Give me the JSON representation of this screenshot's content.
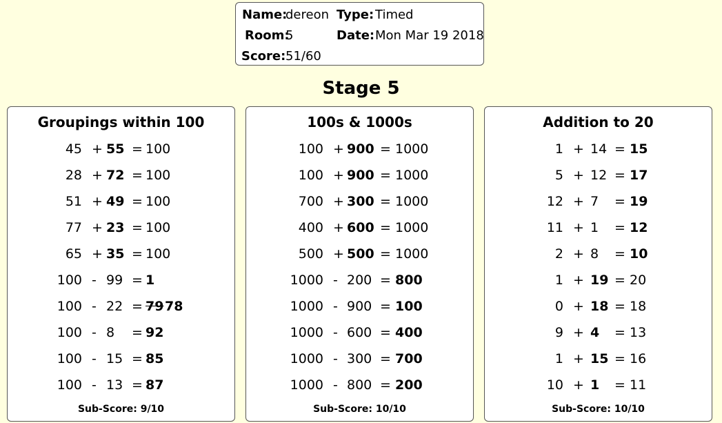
{
  "info": {
    "name_label": "Name:",
    "name_value": "dereon",
    "type_label": "Type:",
    "type_value": "Timed",
    "room_label": "Room:",
    "room_value": "5",
    "date_label": "Date:",
    "date_value": "Mon Mar 19 2018",
    "score_label": "Score:",
    "score_value": "51/60"
  },
  "stage_title": "Stage 5",
  "panels": [
    {
      "title": "Groupings within 100",
      "subscore": "Sub-Score: 9/10",
      "rows": [
        {
          "a": "45",
          "op": "+",
          "b": "55",
          "eq": "=",
          "c": "100",
          "bold": "b"
        },
        {
          "a": "28",
          "op": "+",
          "b": "72",
          "eq": "=",
          "c": "100",
          "bold": "b"
        },
        {
          "a": "51",
          "op": "+",
          "b": "49",
          "eq": "=",
          "c": "100",
          "bold": "b"
        },
        {
          "a": "77",
          "op": "+",
          "b": "23",
          "eq": "=",
          "c": "100",
          "bold": "b"
        },
        {
          "a": "65",
          "op": "+",
          "b": "35",
          "eq": "=",
          "c": "100",
          "bold": "b"
        },
        {
          "a": "100",
          "op": "-",
          "b": "99",
          "eq": "=",
          "c": "1",
          "bold": "c"
        },
        {
          "a": "100",
          "op": "-",
          "b": "22",
          "eq": "=",
          "c": "79",
          "c_correct": "78",
          "bold": "c"
        },
        {
          "a": "100",
          "op": "-",
          "b": "8",
          "eq": "=",
          "c": "92",
          "bold": "c"
        },
        {
          "a": "100",
          "op": "-",
          "b": "15",
          "eq": "=",
          "c": "85",
          "bold": "c"
        },
        {
          "a": "100",
          "op": "-",
          "b": "13",
          "eq": "=",
          "c": "87",
          "bold": "c"
        }
      ]
    },
    {
      "title": "100s & 1000s",
      "subscore": "Sub-Score: 10/10",
      "rows": [
        {
          "a": "100",
          "op": "+",
          "b": "900",
          "eq": "=",
          "c": "1000",
          "bold": "b"
        },
        {
          "a": "100",
          "op": "+",
          "b": "900",
          "eq": "=",
          "c": "1000",
          "bold": "b"
        },
        {
          "a": "700",
          "op": "+",
          "b": "300",
          "eq": "=",
          "c": "1000",
          "bold": "b"
        },
        {
          "a": "400",
          "op": "+",
          "b": "600",
          "eq": "=",
          "c": "1000",
          "bold": "b"
        },
        {
          "a": "500",
          "op": "+",
          "b": "500",
          "eq": "=",
          "c": "1000",
          "bold": "b"
        },
        {
          "a": "1000",
          "op": "-",
          "b": "200",
          "eq": "=",
          "c": "800",
          "bold": "c"
        },
        {
          "a": "1000",
          "op": "-",
          "b": "900",
          "eq": "=",
          "c": "100",
          "bold": "c"
        },
        {
          "a": "1000",
          "op": "-",
          "b": "600",
          "eq": "=",
          "c": "400",
          "bold": "c"
        },
        {
          "a": "1000",
          "op": "-",
          "b": "300",
          "eq": "=",
          "c": "700",
          "bold": "c"
        },
        {
          "a": "1000",
          "op": "-",
          "b": "800",
          "eq": "=",
          "c": "200",
          "bold": "c"
        }
      ]
    },
    {
      "title": "Addition to 20",
      "subscore": "Sub-Score: 10/10",
      "rows": [
        {
          "a": "1",
          "op": "+",
          "b": "14",
          "eq": "=",
          "c": "15",
          "bold": "c"
        },
        {
          "a": "5",
          "op": "+",
          "b": "12",
          "eq": "=",
          "c": "17",
          "bold": "c"
        },
        {
          "a": "12",
          "op": "+",
          "b": "7",
          "eq": "=",
          "c": "19",
          "bold": "c"
        },
        {
          "a": "11",
          "op": "+",
          "b": "1",
          "eq": "=",
          "c": "12",
          "bold": "c"
        },
        {
          "a": "2",
          "op": "+",
          "b": "8",
          "eq": "=",
          "c": "10",
          "bold": "c"
        },
        {
          "a": "1",
          "op": "+",
          "b": "19",
          "eq": "=",
          "c": "20",
          "bold": "b"
        },
        {
          "a": "0",
          "op": "+",
          "b": "18",
          "eq": "=",
          "c": "18",
          "bold": "b"
        },
        {
          "a": "9",
          "op": "+",
          "b": "4",
          "eq": "=",
          "c": "13",
          "bold": "b"
        },
        {
          "a": "1",
          "op": "+",
          "b": "15",
          "eq": "=",
          "c": "16",
          "bold": "b"
        },
        {
          "a": "10",
          "op": "+",
          "b": "1",
          "eq": "=",
          "c": "11",
          "bold": "b"
        }
      ]
    }
  ]
}
